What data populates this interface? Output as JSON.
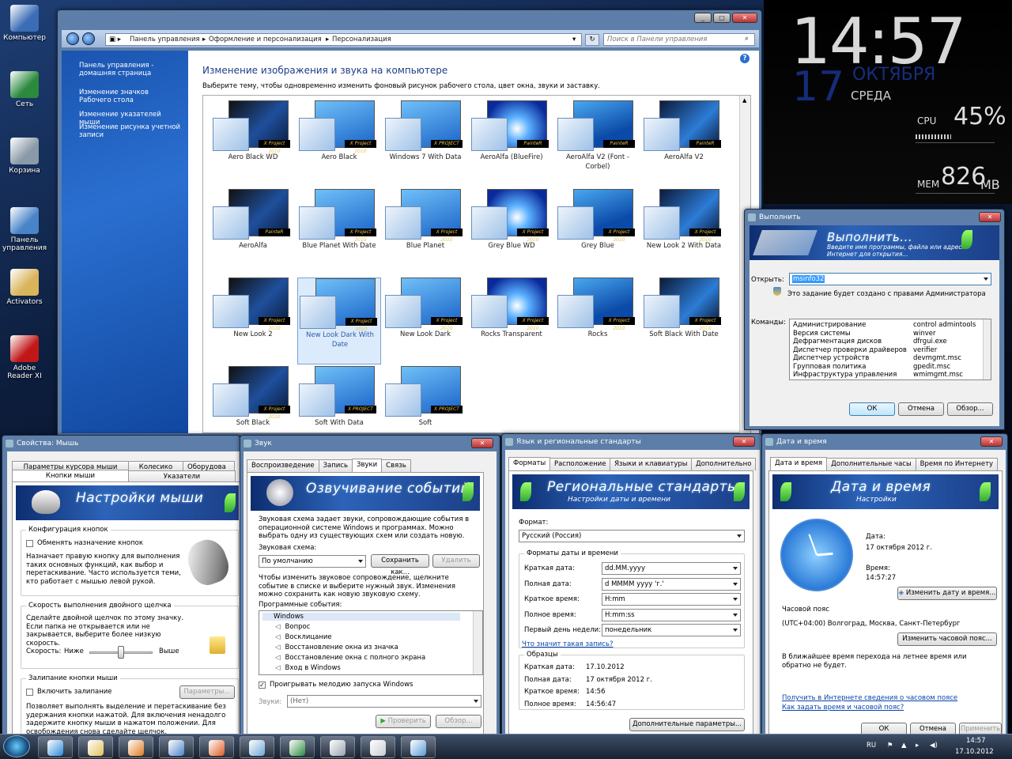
{
  "desktop": {
    "icons": [
      {
        "label": "Компьютер",
        "color": "#3a6db5"
      },
      {
        "label": "Сеть",
        "color": "#2b8a3e"
      },
      {
        "label": "Корзина",
        "color": "#8a9aa8"
      },
      {
        "label": "Панель управления",
        "color": "#4a84c8"
      },
      {
        "label": "Activators",
        "color": "#d8b45a"
      },
      {
        "label": "Adobe Reader XI",
        "color": "#c01818"
      }
    ]
  },
  "gadget": {
    "time": "14:57",
    "day": "17",
    "month": "ОКТЯБРЯ",
    "weekday": "СРЕДА",
    "cpu_label": "CPU",
    "cpu_value": "45%",
    "cpu_percent": 45,
    "mem_label": "MEM",
    "mem_value": "826",
    "mem_unit": "MB"
  },
  "control_panel": {
    "breadcrumb": [
      "Панель управления",
      "Оформление и персонализация",
      "Персонализация"
    ],
    "search_placeholder": "Поиск в Панели управления",
    "side_links": [
      "Панель управления - домашняя страница",
      "Изменение значков Рабочего стола",
      "Изменение указателей мыши",
      "Изменение рисунка учетной записи"
    ],
    "title": "Изменение изображения и звука на компьютере",
    "subtitle": "Выберите тему, чтобы одновременно изменить фоновый рисунок рабочего стола, цвет окна, звуки и заставку.",
    "themes": [
      {
        "name": "Aero Black WD",
        "tag": "X Project 2010"
      },
      {
        "name": "Aero Black",
        "tag": "X Project 2010"
      },
      {
        "name": "Windows 7 With Data",
        "tag": "X PROJECT"
      },
      {
        "name": "AeroAlfa (BlueFire)",
        "tag": "PainteR"
      },
      {
        "name": "AeroAlfa V2 (Font - Corbel)",
        "tag": "PainteR"
      },
      {
        "name": "AeroAlfa V2",
        "tag": "PainteR"
      },
      {
        "name": "AeroAlfa",
        "tag": "PainteR"
      },
      {
        "name": "Blue Planet With Date",
        "tag": "X Project 2010"
      },
      {
        "name": "Blue Planet",
        "tag": "X Project 2010"
      },
      {
        "name": "Grey Blue WD",
        "tag": "X Project 2010"
      },
      {
        "name": "Grey Blue",
        "tag": "X Project 2010"
      },
      {
        "name": "New Look 2 With Data",
        "tag": "X Project 2010"
      },
      {
        "name": "New Look 2",
        "tag": "X Project 2010"
      },
      {
        "name": "New Look Dark With Date",
        "tag": "X Project 2010"
      },
      {
        "name": "New Look Dark",
        "tag": "X Project 2010"
      },
      {
        "name": "Rocks Transparent",
        "tag": "X Project 2010"
      },
      {
        "name": "Rocks",
        "tag": "X Project 2010"
      },
      {
        "name": "Soft Black With Date",
        "tag": "X Project 2010"
      },
      {
        "name": "Soft Black",
        "tag": "X Project 2010"
      },
      {
        "name": "Soft With Data",
        "tag": "X PROJECT"
      },
      {
        "name": "Soft",
        "tag": "X PROJECT"
      }
    ],
    "selected_index": 13
  },
  "run": {
    "title": "Выполнить",
    "banner_title": "Выполнить...",
    "banner_sub": "Введите имя программы, файла или адрес в Интернет для открытия...",
    "open_label": "Открыть:",
    "open_value": "msinfo32",
    "admin_note": "Это задание будет создано с правами Администратора",
    "commands_label": "Команды:",
    "commands": [
      {
        "name": "Администрирование",
        "cmd": "control admintools"
      },
      {
        "name": "Версия системы",
        "cmd": "winver"
      },
      {
        "name": "Дефрагментация дисков",
        "cmd": "dfrgui.exe"
      },
      {
        "name": "Диспетчер проверки драйверов",
        "cmd": "verifier"
      },
      {
        "name": "Диспетчер устройств",
        "cmd": "devmgmt.msc"
      },
      {
        "name": "Групповая политика",
        "cmd": "gpedit.msc"
      },
      {
        "name": "Инфраструктура управления",
        "cmd": "wmimgmt.msc"
      }
    ],
    "ok": "ОК",
    "cancel": "Отмена",
    "browse": "Обзор..."
  },
  "mouse": {
    "title": "Свойства: Мышь",
    "tabs_row1": [
      "Параметры курсора мыши",
      "Колесико",
      "Оборудова"
    ],
    "tabs_row2": [
      "Кнопки мыши",
      "Указатели"
    ],
    "banner": "Настройки мыши",
    "group1": "Конфигурация кнопок",
    "swap_label": "Обменять назначение кнопок",
    "group1_desc": "Назначает правую кнопку для выполнения таких основных функций, как выбор и перетаскивание. Часто используется теми, кто работает с мышью левой рукой.",
    "group2": "Скорость выполнения двойного щелчка",
    "group2_desc": "Сделайте двойной щелчок по этому значку. Если папка не открывается или не закрывается, выберите более низкую скорость.",
    "speed_label": "Скорость:",
    "slow": "Ниже",
    "fast": "Выше",
    "speed_fraction": 0.5,
    "group3": "Залипание кнопки мыши",
    "clicklock_label": "Включить залипание",
    "params_button": "Параметры...",
    "group3_desc": "Позволяет выполнять выделение и перетаскивание без удержания кнопки нажатой. Для включения ненадолго задержите кнопку мыши в нажатом положении. Для освобождения снова сделайте щелчок."
  },
  "sound": {
    "title": "Звук",
    "tabs": [
      "Воспроизведение",
      "Запись",
      "Звуки",
      "Связь"
    ],
    "active_tab": 2,
    "banner": "Озвучивание событий",
    "desc1": "Звуковая схема задает звуки, сопровождающие события в операционной системе Windows и программах. Можно выбрать одну из существующих схем или создать новую.",
    "scheme_label": "Звуковая схема:",
    "scheme_value": "По умолчанию",
    "save_as": "Сохранить как...",
    "delete": "Удалить",
    "desc2": "Чтобы изменить звуковое сопровождение, щелкните событие в списке и выберите нужный звук. Изменения можно сохранить как новую звуковую схему.",
    "events_label": "Программные события:",
    "events": [
      "Windows",
      "Вопрос",
      "Восклицание",
      "Восстановление окна из значка",
      "Восстановление окна с полного экрана",
      "Вход в Windows"
    ],
    "startup_label": "Проигрывать мелодию запуска Windows",
    "sounds_label": "Звуки:",
    "sounds_value": "(Нет)",
    "test": "Проверить",
    "browse": "Обзор..."
  },
  "region": {
    "title": "Язык и региональные стандарты",
    "tabs": [
      "Форматы",
      "Расположение",
      "Языки и клавиатуры",
      "Дополнительно"
    ],
    "banner": "Региональные стандарты",
    "banner_sub": "Настройки даты и времени",
    "format_label": "Формат:",
    "format_value": "Русский (Россия)",
    "group1": "Форматы даты и времени",
    "rows": [
      {
        "label": "Краткая дата:",
        "value": "dd.MM.yyyy"
      },
      {
        "label": "Полная дата:",
        "value": "d MMMM yyyy 'г.'"
      },
      {
        "label": "Краткое время:",
        "value": "H:mm"
      },
      {
        "label": "Полное время:",
        "value": "H:mm:ss"
      },
      {
        "label": "Первый день недели:",
        "value": "понедельник"
      }
    ],
    "link": "Что значит такая запись?",
    "group2": "Образцы",
    "samples": [
      {
        "label": "Краткая дата:",
        "value": "17.10.2012"
      },
      {
        "label": "Полная дата:",
        "value": "17 октября 2012 г."
      },
      {
        "label": "Краткое время:",
        "value": "14:56"
      },
      {
        "label": "Полное время:",
        "value": "14:56:47"
      }
    ],
    "advanced": "Дополнительные параметры..."
  },
  "datetime": {
    "title": "Дата и время",
    "tabs": [
      "Дата и время",
      "Дополнительные часы",
      "Время по Интернету"
    ],
    "banner": "Дата и время",
    "banner_sub": "Настройки",
    "date_label": "Дата:",
    "date_value": "17 октября 2012 г.",
    "time_label": "Время:",
    "time_value": "14:57:27",
    "change_button": "Изменить дату и время...",
    "tz_label": "Часовой пояс",
    "tz_value": "(UTC+04:00) Волгоград, Москва, Санкт-Петербург",
    "change_tz": "Изменить часовой пояс...",
    "dst_note": "В ближайшее время перехода на летнее время или обратно не будет.",
    "link1": "Получить в Интернете сведения о часовом поясе",
    "link2": "Как задать время и часовой пояс?",
    "ok": "ОК",
    "cancel": "Отмена",
    "apply": "Применить"
  },
  "taskbar": {
    "lang": "RU",
    "time": "14:57",
    "date": "17.10.2012",
    "items": [
      {
        "icon": "ie-icon",
        "color": "#2a8ad8"
      },
      {
        "icon": "explorer-icon",
        "color": "#e3c05a"
      },
      {
        "icon": "media-player-icon",
        "color": "#e07a20"
      },
      {
        "icon": "control-panel-icon",
        "color": "#4a84c8"
      },
      {
        "icon": "firefox-icon",
        "color": "#e05a20"
      },
      {
        "icon": "region-icon",
        "color": "#6ea6d8"
      },
      {
        "icon": "network-icon",
        "color": "#2b8a3e"
      },
      {
        "icon": "sound-icon",
        "color": "#9aa4ae"
      },
      {
        "icon": "mouse-icon",
        "color": "#c8ccd0"
      },
      {
        "icon": "run-icon",
        "color": "#5a9ad8"
      }
    ]
  }
}
